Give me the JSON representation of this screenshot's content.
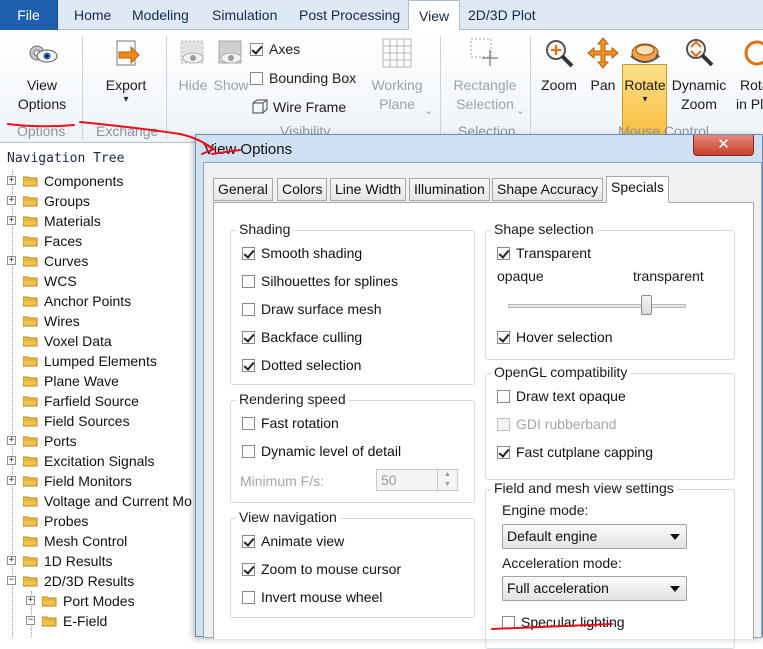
{
  "ribbon_tabs": [
    {
      "label": "File"
    },
    {
      "label": "Home"
    },
    {
      "label": "Modeling"
    },
    {
      "label": "Simulation"
    },
    {
      "label": "Post Processing"
    },
    {
      "label": "View"
    },
    {
      "label": "2D/3D Plot"
    }
  ],
  "ribbon": {
    "view_options": {
      "line1": "View",
      "line2": "Options"
    },
    "export": {
      "label": "Export",
      "arrow": "▾"
    },
    "hide": "Hide",
    "show": "Show",
    "axes": "Axes",
    "bounding_box": "Bounding Box",
    "wire_frame": "Wire Frame",
    "working_plane": {
      "line1": "Working",
      "line2": "Plane"
    },
    "rectangle_selection": {
      "line1": "Rectangle",
      "line2": "Selection"
    },
    "zoom": "Zoom",
    "pan": "Pan",
    "rotate": {
      "label": "Rotate",
      "arrow": "▾"
    },
    "dynamic_zoom": {
      "line1": "Dynamic",
      "line2": "Zoom"
    },
    "rotate_in_plane": {
      "line1": "Rota",
      "line2": "in Pl"
    },
    "groups": {
      "options": "Options",
      "exchange": "Exchange",
      "visibility": "Visibility",
      "selection": "Selection",
      "mouse_control": "Mouse Control"
    },
    "dropdown_arrow": "⌄"
  },
  "nav": {
    "title": "Navigation Tree",
    "items": [
      {
        "label": "Components",
        "expander": "+"
      },
      {
        "label": "Groups",
        "expander": "+"
      },
      {
        "label": "Materials",
        "expander": "+"
      },
      {
        "label": "Faces",
        "expander": ""
      },
      {
        "label": "Curves",
        "expander": "+"
      },
      {
        "label": "WCS",
        "expander": ""
      },
      {
        "label": "Anchor Points",
        "expander": ""
      },
      {
        "label": "Wires",
        "expander": ""
      },
      {
        "label": "Voxel Data",
        "expander": ""
      },
      {
        "label": "Lumped Elements",
        "expander": ""
      },
      {
        "label": "Plane Wave",
        "expander": ""
      },
      {
        "label": "Farfield Source",
        "expander": ""
      },
      {
        "label": "Field Sources",
        "expander": ""
      },
      {
        "label": "Ports",
        "expander": "+"
      },
      {
        "label": "Excitation Signals",
        "expander": "+"
      },
      {
        "label": "Field Monitors",
        "expander": "+"
      },
      {
        "label": "Voltage and Current Mo",
        "expander": ""
      },
      {
        "label": "Probes",
        "expander": ""
      },
      {
        "label": "Mesh Control",
        "expander": ""
      },
      {
        "label": "1D Results",
        "expander": "+"
      },
      {
        "label": "2D/3D Results",
        "expander": "−"
      },
      {
        "label": "Port Modes",
        "expander": "+"
      },
      {
        "label": "E-Field",
        "expander": "−"
      }
    ]
  },
  "dialog": {
    "title": "View Options",
    "close": "✕",
    "tabs": [
      {
        "label": "General"
      },
      {
        "label": "Colors"
      },
      {
        "label": "Line Width"
      },
      {
        "label": "Illumination"
      },
      {
        "label": "Shape Accuracy"
      },
      {
        "label": "Specials"
      }
    ],
    "shading": {
      "title": "Shading",
      "options": [
        {
          "label": "Smooth shading",
          "checked": true
        },
        {
          "label": "Silhouettes for splines",
          "checked": false
        },
        {
          "label": "Draw surface mesh",
          "checked": false
        },
        {
          "label": "Backface culling",
          "checked": true
        },
        {
          "label": "Dotted selection",
          "checked": true
        }
      ]
    },
    "rendering_speed": {
      "title": "Rendering speed",
      "fast_rotation": "Fast rotation",
      "dynamic_lod": "Dynamic level of detail",
      "min_fps_label": "Minimum F/s:",
      "min_fps_value": "50"
    },
    "view_navigation": {
      "title": "View navigation",
      "options": [
        {
          "label": "Animate view",
          "checked": true
        },
        {
          "label": "Zoom to mouse cursor",
          "checked": true
        },
        {
          "label": "Invert mouse wheel",
          "checked": false
        }
      ]
    },
    "shape_selection": {
      "title": "Shape selection",
      "transparent": "Transparent",
      "opaque": "opaque",
      "transparent_end": "transparent",
      "slider_fraction": 0.78,
      "hover": "Hover selection"
    },
    "opengl": {
      "title": "OpenGL compatibility",
      "draw_text_opaque": "Draw text opaque",
      "gdi_rubberband": "GDI rubberband",
      "fast_cutplane": "Fast cutplane capping"
    },
    "field_mesh": {
      "title": "Field and mesh view settings",
      "engine_label": "Engine mode:",
      "engine_value": "Default engine",
      "accel_label": "Acceleration mode:",
      "accel_value": "Full acceleration",
      "specular": "Specular lighting"
    }
  },
  "colors": {
    "annotation_red": "#e8101a",
    "file_tab": "#1f5fb0",
    "rotate_highlight": "#f7b732",
    "dialog_frame": "#cfe0f3",
    "close_button": "#c9402a"
  }
}
